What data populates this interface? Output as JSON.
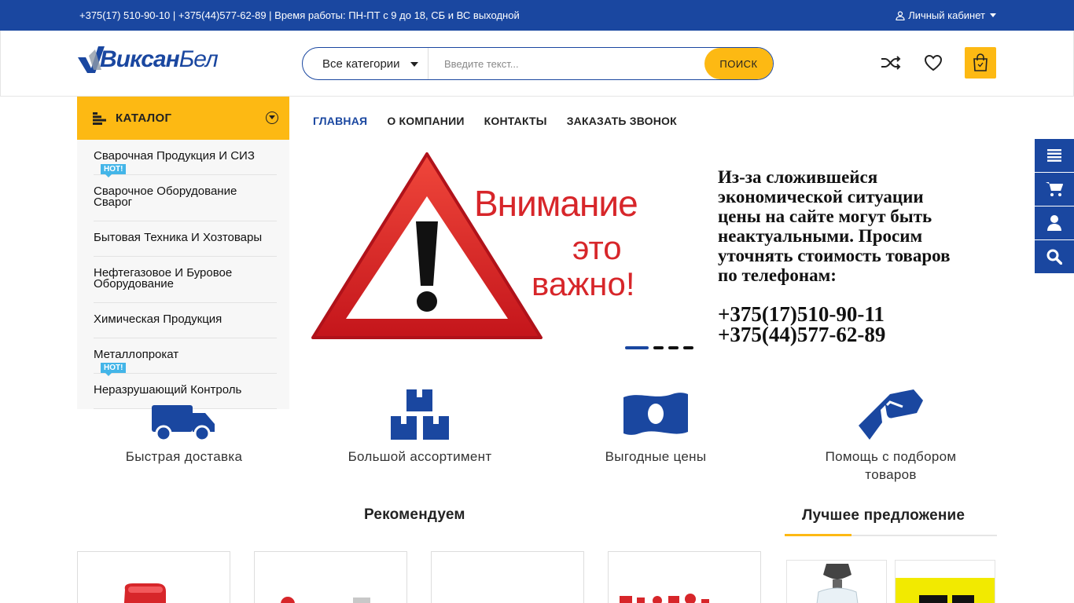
{
  "topbar": {
    "contacts": "+375(17) 510-90-10 |  +375(44)577-62-89 | Время работы: ПН-ПТ с 9 до 18, СБ и ВС выходной",
    "account_label": "Личный кабинет"
  },
  "header": {
    "logo_part1": "Виксан",
    "logo_part2": "Бел",
    "search_category": "Все категории",
    "search_placeholder": "Введите текст...",
    "search_button": "Поиск",
    "icons": [
      "shuffle-icon",
      "heart-icon",
      "shopping-bag-icon"
    ]
  },
  "catalog": {
    "title": "КАТАЛОГ",
    "items": [
      {
        "label": "Сварочная Продукция И СИЗ",
        "badge": "HOT!"
      },
      {
        "label": "Сварочное Оборудование Сварог",
        "badge": ""
      },
      {
        "label": "Бытовая Техника И Хозтовары",
        "badge": ""
      },
      {
        "label": "Нефтегазовое И Буровое Оборудование",
        "badge": ""
      },
      {
        "label": "Химическая Продукция",
        "badge": ""
      },
      {
        "label": "Металлопрокат",
        "badge": "HOT!"
      },
      {
        "label": "Неразрушающий Контроль",
        "badge": ""
      }
    ]
  },
  "nav": {
    "items": [
      "ГЛАВНАЯ",
      "О КОМПАНИИ",
      "КОНТАКТЫ",
      "ЗАКАЗАТЬ ЗВОНОК"
    ]
  },
  "banner": {
    "warning_line1": "Внимание",
    "warning_line2": "это",
    "warning_line3": "важно!",
    "notice": "Из-за сложившейся\nэкономической ситуации\nцены на сайте могут быть\nнеактуальными. Просим\nуточнять стоимость товаров\nпо телефонам:",
    "phone1": "+375(17)510-90-11",
    "phone2": "+375(44)577-62-89",
    "slides_total": 4,
    "active_slide": 1
  },
  "features": [
    {
      "label": "Быстрая доставка",
      "icon": "truck-icon"
    },
    {
      "label": "Большой ассортимент",
      "icon": "boxes-icon"
    },
    {
      "label": "Выгодные цены",
      "icon": "money-icon"
    },
    {
      "label": "Помощь с подбором товаров",
      "icon": "handshake-icon"
    }
  ],
  "sections": {
    "recommended": "Рекомендуем",
    "best_offer": "Лучшее предложение"
  },
  "side_buttons": [
    "menu-icon",
    "cart-icon",
    "user-icon",
    "search-icon"
  ],
  "colors": {
    "primary": "#1a47a0",
    "accent": "#fdb913",
    "hot_badge": "#43b5e8",
    "warning_red": "#d7262a"
  }
}
